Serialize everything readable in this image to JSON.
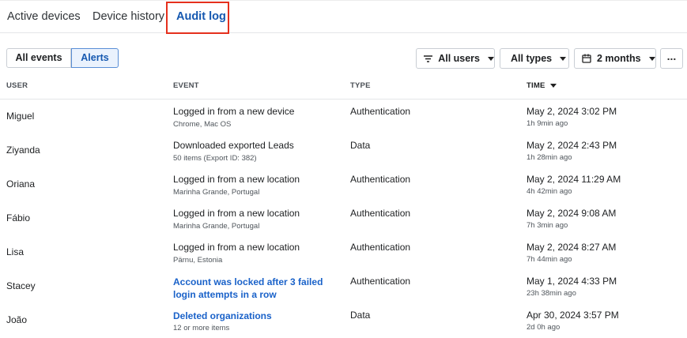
{
  "tabs": [
    {
      "label": "Active devices"
    },
    {
      "label": "Device history"
    },
    {
      "label": "Audit log"
    }
  ],
  "toolbar": {
    "segments": [
      "All events",
      "Alerts"
    ],
    "filters": {
      "users": "All users",
      "types": "All types",
      "period": "2 months"
    },
    "more_label": "..."
  },
  "table": {
    "columns": [
      "USER",
      "EVENT",
      "TYPE",
      "TIME"
    ],
    "rows": [
      {
        "user": "Miguel",
        "event": "Logged in from a new device",
        "detail": "Chrome, Mac OS",
        "type": "Authentication",
        "time": "May 2, 2024 3:02 PM",
        "ago": "1h 9min ago",
        "alert": false
      },
      {
        "user": "Ziyanda",
        "event": "Downloaded exported Leads",
        "detail": "50 items (Export ID: 382)",
        "type": "Data",
        "time": "May 2, 2024 2:43 PM",
        "ago": "1h 28min ago",
        "alert": false
      },
      {
        "user": "Oriana",
        "event": "Logged in from a new location",
        "detail": "Marinha Grande, Portugal",
        "type": "Authentication",
        "time": "May 2, 2024 11:29 AM",
        "ago": "4h 42min ago",
        "alert": false
      },
      {
        "user": "Fábio",
        "event": "Logged in from a new location",
        "detail": "Marinha Grande, Portugal",
        "type": "Authentication",
        "time": "May 2, 2024 9:08 AM",
        "ago": "7h 3min ago",
        "alert": false
      },
      {
        "user": "Lisa",
        "event": "Logged in from a new location",
        "detail": "Pärnu, Estonia",
        "type": "Authentication",
        "time": "May 2, 2024 8:27 AM",
        "ago": "7h 44min ago",
        "alert": false
      },
      {
        "user": "Stacey",
        "event": "Account was locked after 3 failed login attempts in a row",
        "detail": "",
        "type": "Authentication",
        "time": "May 1, 2024 4:33 PM",
        "ago": "23h 38min ago",
        "alert": true
      },
      {
        "user": "João",
        "event": "Deleted organizations",
        "detail": "12 or more items",
        "type": "Data",
        "time": "Apr 30, 2024 3:57 PM",
        "ago": "2d 0h ago",
        "alert": true
      }
    ]
  },
  "colors": {
    "accent": "#1558b0",
    "alert_link": "#1a62c9",
    "highlight_box": "#e5301d"
  },
  "icons": {
    "users_filter": "filter-lines-icon",
    "period_filter": "calendar-icon",
    "dropdown": "caret-down-icon",
    "sort": "sort-desc-icon"
  }
}
